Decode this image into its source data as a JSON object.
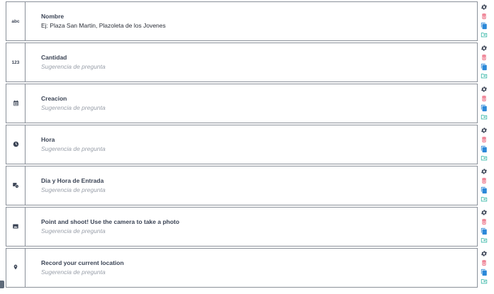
{
  "colors": {
    "gear": "#3b4455",
    "trash": "#e8526b",
    "copy": "#2b88d8",
    "folder": "#35b6a6"
  },
  "questions": [
    {
      "type_icon": "abc-text-icon",
      "type_text": "abc",
      "label": "Nombre",
      "hint": "Ej: Plaza San Martin, Plazoleta de los Jovenes"
    },
    {
      "type_icon": "number-icon",
      "type_text": "123",
      "label": "Cantidad",
      "hint": "Sugerencia de pregunta"
    },
    {
      "type_icon": "calendar-icon",
      "type_text": "",
      "label": "Creacion",
      "hint": "Sugerencia de pregunta"
    },
    {
      "type_icon": "clock-icon",
      "type_text": "",
      "label": "Hora",
      "hint": "Sugerencia de pregunta"
    },
    {
      "type_icon": "datetime-icon",
      "type_text": "",
      "label": "Dia y Hora de Entrada",
      "hint": "Sugerencia de pregunta"
    },
    {
      "type_icon": "photo-icon",
      "type_text": "",
      "label": "Point and shoot! Use the camera to take a photo",
      "hint": "Sugerencia de pregunta"
    },
    {
      "type_icon": "location-pin-icon",
      "type_text": "",
      "label": "Record your current location",
      "hint": "Sugerencia de pregunta"
    }
  ]
}
